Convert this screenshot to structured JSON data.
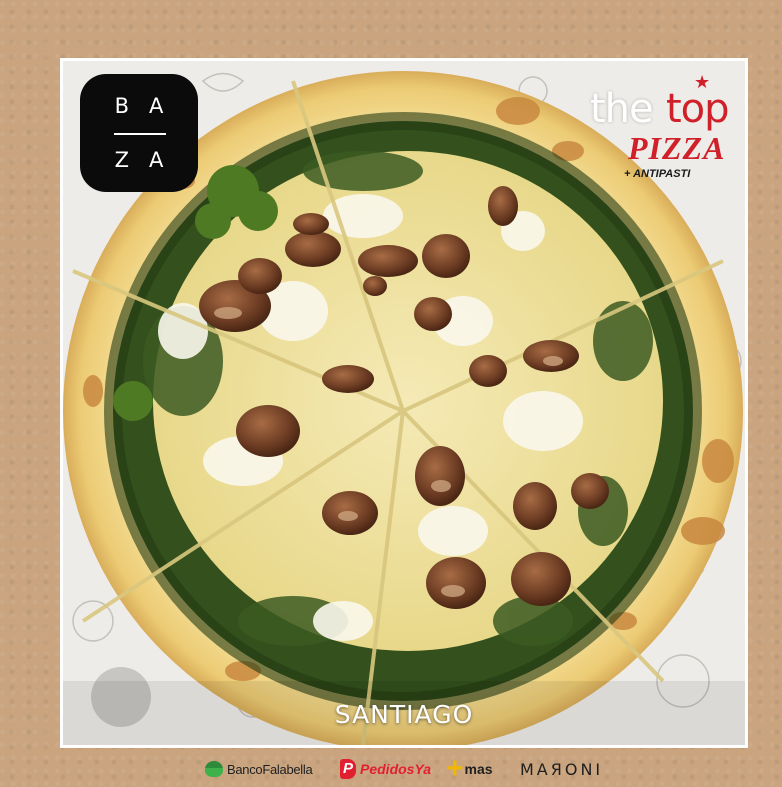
{
  "brand": {
    "baza_line1": "BA",
    "baza_line2": "ZA",
    "thetop_the": "the",
    "thetop_top": "top",
    "thetop_star": "★",
    "thetop_pizza": "PIZZA",
    "thetop_antipasti": "+ ANTIPASTI"
  },
  "caption": {
    "city": "SANTIAGO"
  },
  "sponsors": {
    "falabella": "BancoFalabella",
    "pedidosya_mark": "P",
    "pedidosya": "PedidosYa",
    "mas_mark": "+",
    "mas": "mas",
    "maroni": "MAЯONI"
  },
  "colors": {
    "background": "#c9a47f",
    "brand_red": "#d0202a",
    "pesto": "#2f4a1a",
    "cheese": "#f0e2a0",
    "crust": "#f3dc8e"
  }
}
